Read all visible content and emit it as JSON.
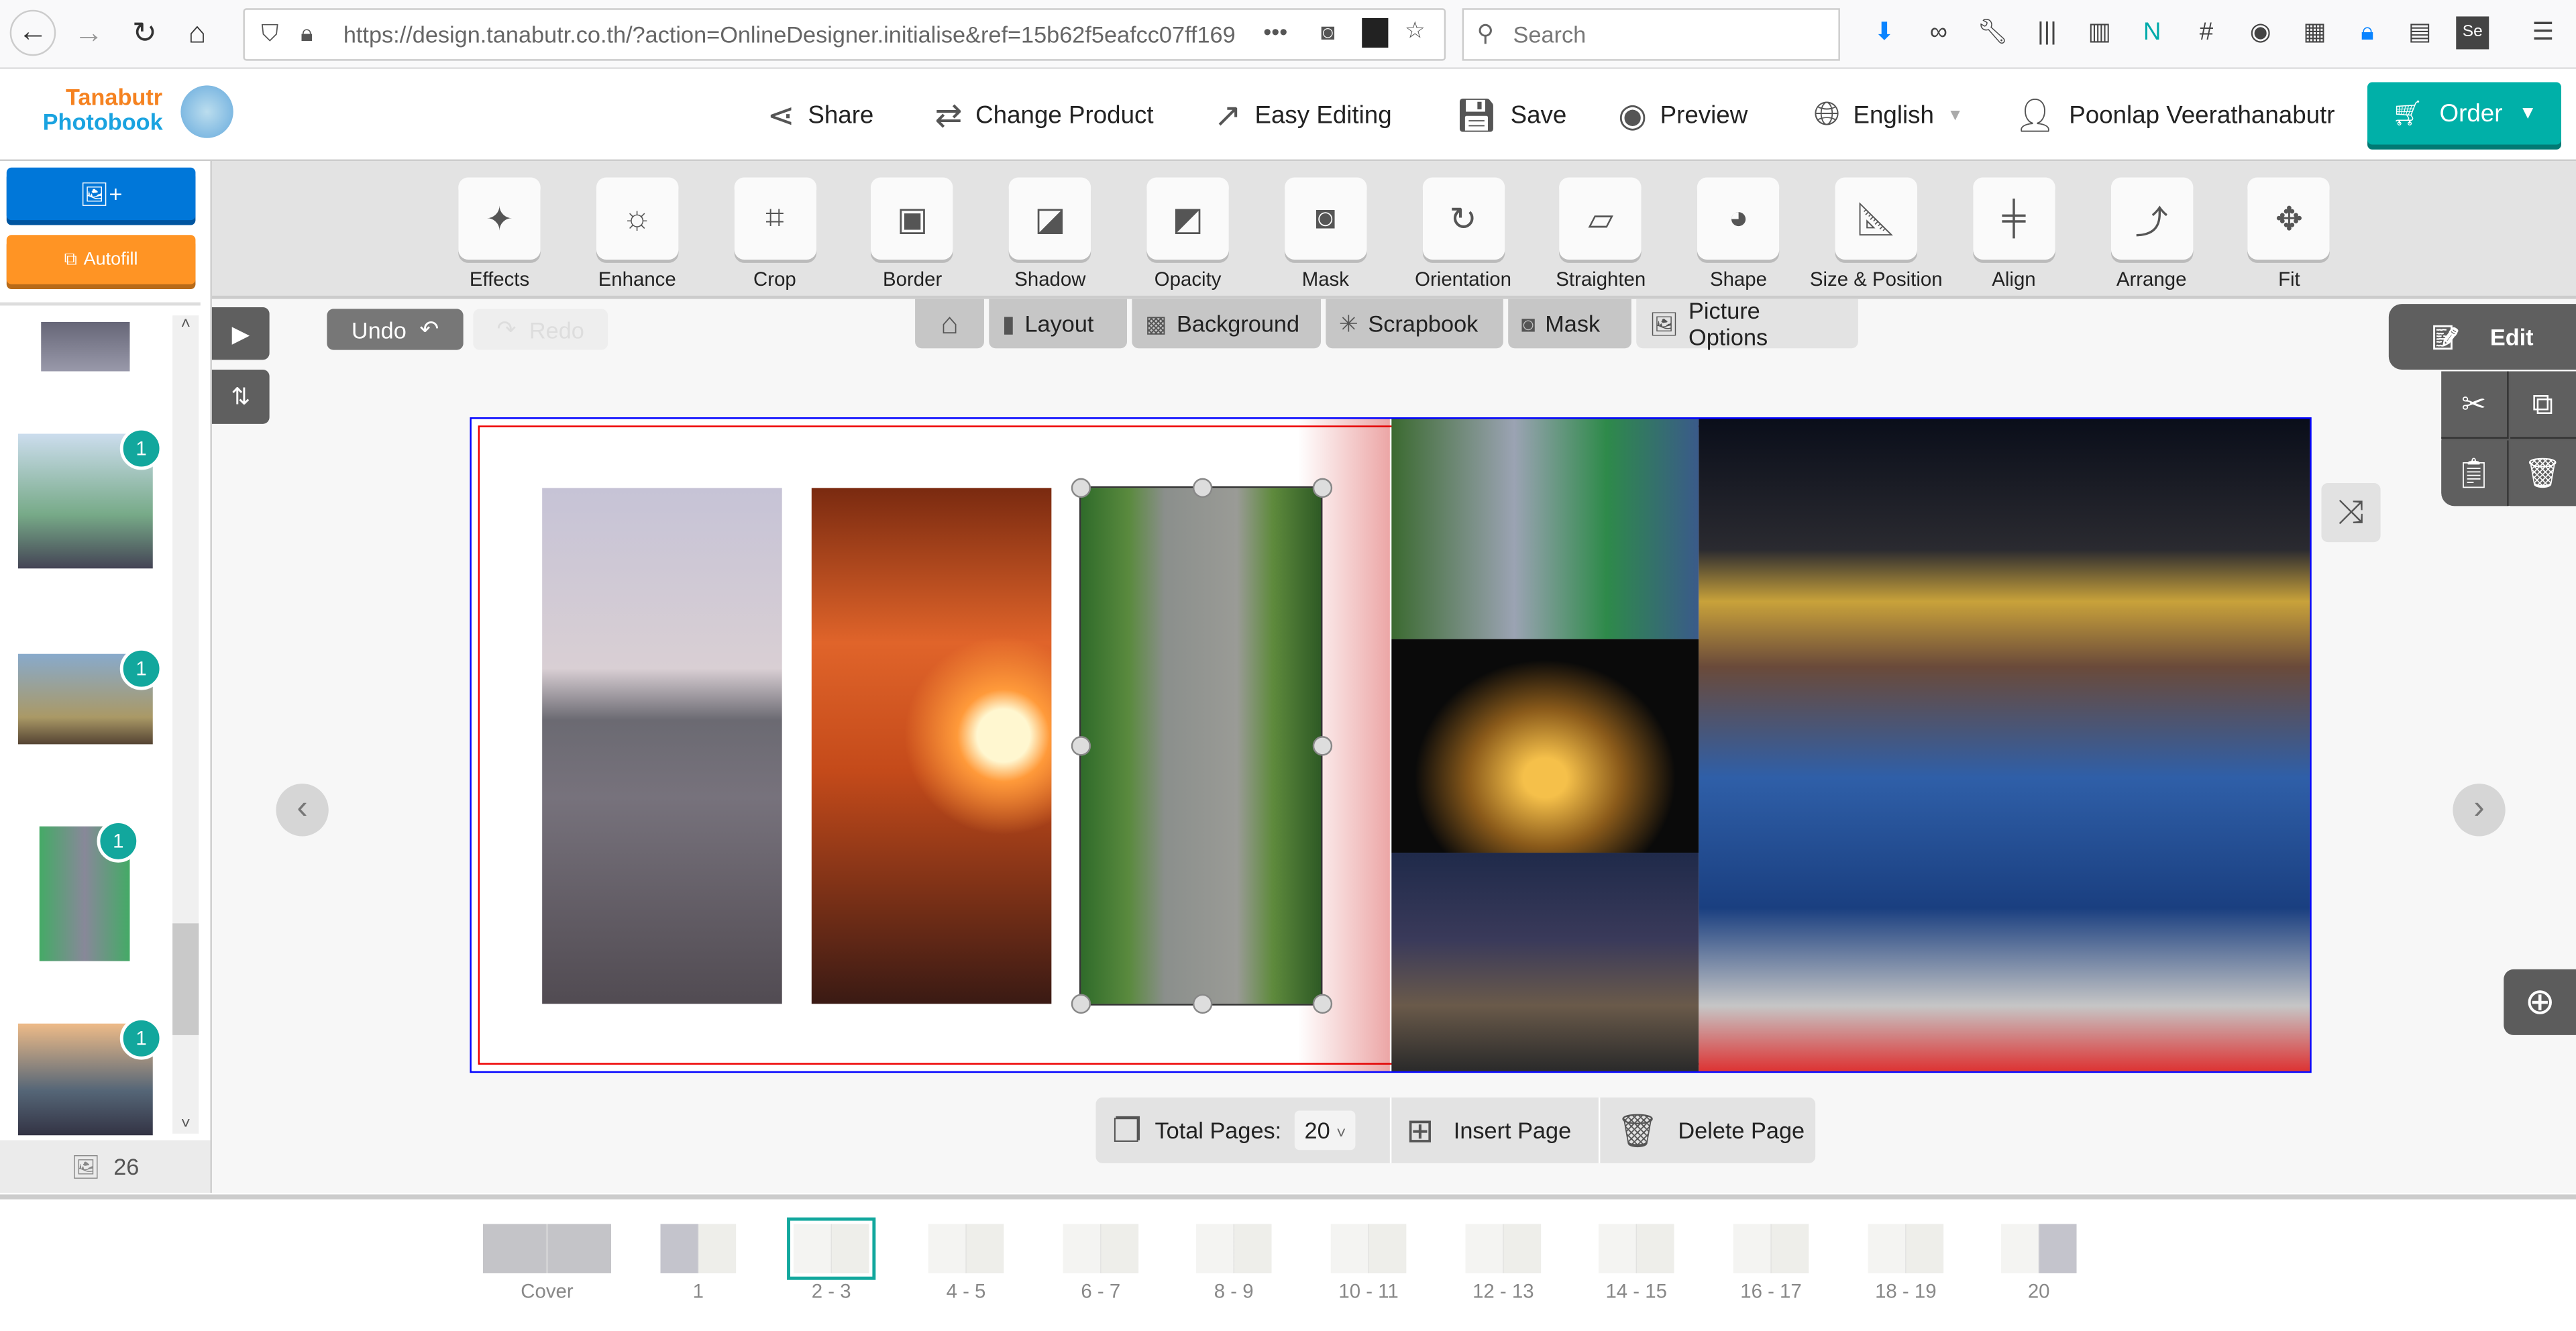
{
  "browser": {
    "url": "https://design.tanabutr.co.th/?action=OnlineDesigner.initialise&ref=15b62f5eafcc07ff169",
    "search_placeholder": "Search"
  },
  "app": {
    "logo_line1": "Tanabutr",
    "logo_line2": "Photobook",
    "nav": [
      {
        "label": "Share",
        "icon": "share-icon"
      },
      {
        "label": "Change Product",
        "icon": "change-product-icon"
      },
      {
        "label": "Easy Editing",
        "icon": "easy-editing-icon"
      },
      {
        "label": "Save",
        "icon": "save-icon"
      },
      {
        "label": "Preview",
        "icon": "eye-icon"
      },
      {
        "label": "English",
        "icon": "globe-icon"
      },
      {
        "label": "Poonlap Veerathanabutr",
        "icon": "user-icon"
      }
    ],
    "order_label": "Order",
    "accent": "#00b0a8"
  },
  "sidebar": {
    "autofill_label": "Autofill",
    "photo_count": "26",
    "badges": [
      "1",
      "1",
      "1",
      "1"
    ]
  },
  "tools": [
    "Effects",
    "Enhance",
    "Crop",
    "Border",
    "Shadow",
    "Opacity",
    "Mask",
    "Orientation",
    "Straighten",
    "Shape",
    "Size & Position",
    "Align",
    "Arrange",
    "Fit"
  ],
  "history": {
    "undo": "Undo",
    "redo": "Redo"
  },
  "tabs": [
    "Layout",
    "Background",
    "Scrapbook",
    "Mask",
    "Picture Options"
  ],
  "edit_panel": {
    "title": "Edit"
  },
  "pages": {
    "total_label": "Total Pages:",
    "total_value": "20",
    "insert": "Insert Page",
    "delete": "Delete Page"
  },
  "thumbnails": [
    "Cover",
    "1",
    "2 - 3",
    "4 - 5",
    "6 - 7",
    "8 - 9",
    "10 - 11",
    "12 - 13",
    "14 - 15",
    "16 - 17",
    "18 - 19",
    "20"
  ],
  "selected_thumbnail": "2 - 3"
}
